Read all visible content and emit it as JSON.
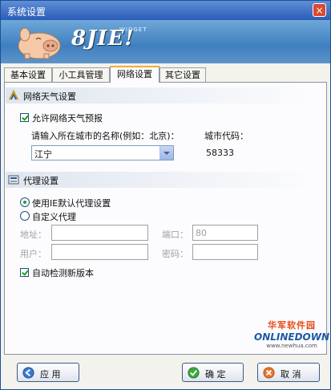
{
  "window": {
    "title": "系统设置",
    "close_label": "×"
  },
  "banner": {
    "logo_text": "8JIE!",
    "widget_text": "WIDGET"
  },
  "tabs": [
    {
      "label": "基本设置",
      "active": false
    },
    {
      "label": "小工具管理",
      "active": false
    },
    {
      "label": "网络设置",
      "active": true
    },
    {
      "label": "其它设置",
      "active": false
    }
  ],
  "weather": {
    "section_title": "网络天气设置",
    "allow_label": "允许网络天气预报",
    "allow_checked": true,
    "city_prompt": "请输入所在城市的名称(例如：北京)：",
    "city_code_label": "城市代码：",
    "city_value": "江宁",
    "city_code_value": "58333"
  },
  "proxy": {
    "section_title": "代理设置",
    "use_ie_label": "使用IE默认代理设置",
    "custom_label": "自定义代理",
    "address_label": "地址：",
    "address_value": "",
    "port_label": "端口：",
    "port_value": "80",
    "user_label": "用户：",
    "user_value": "",
    "password_label": "密码：",
    "password_value": ""
  },
  "auto_update": {
    "label": "自动检测新版本",
    "checked": true
  },
  "watermark": {
    "cn": "华军软件园",
    "en": "ONLINEDOWN",
    "url": "www.newhua.com"
  },
  "buttons": {
    "apply": "应  用",
    "ok": "确  定",
    "cancel": "取  消"
  },
  "colors": {
    "accent": "#2a5cb8",
    "check": "#21a121",
    "tab_highlight": "#f0b030"
  }
}
